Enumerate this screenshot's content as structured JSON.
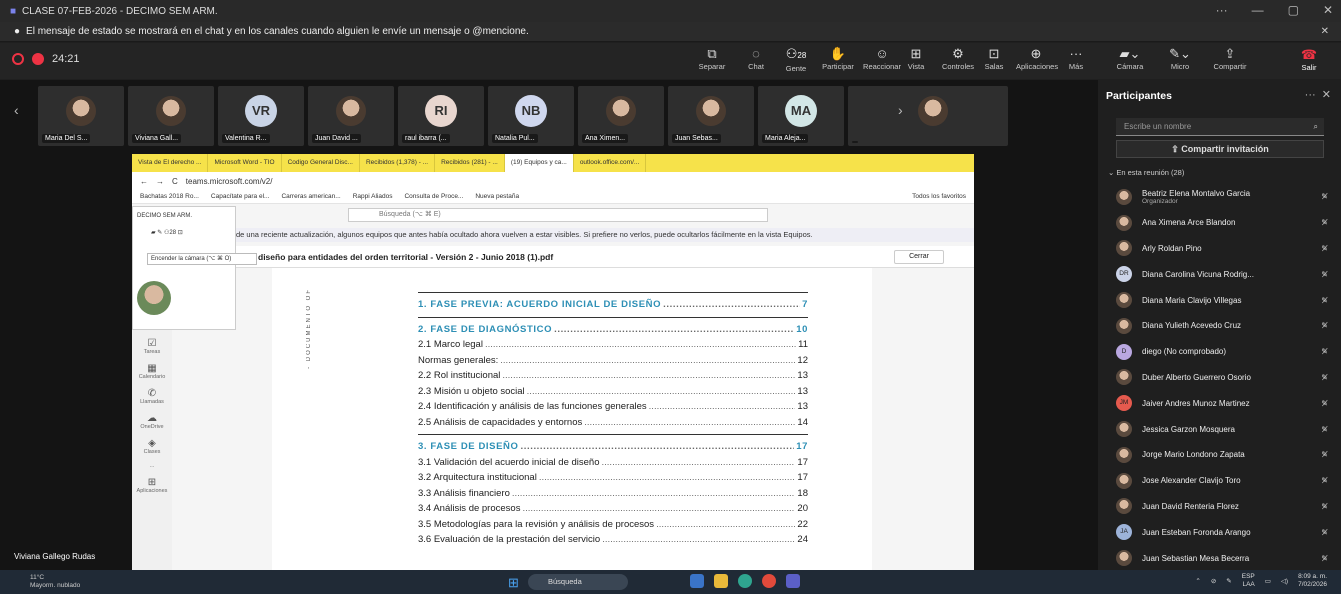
{
  "window": {
    "title": "CLASE 07-FEB-2026 - DECIMO SEM ARM."
  },
  "banner": {
    "message": "El mensaje de estado se mostrará en el chat y en los canales cuando alguien le envíe un mensaje o @mencione."
  },
  "meeting": {
    "timer": "24:21"
  },
  "toolbar": {
    "buttons": [
      "Separar",
      "Chat",
      "Gente",
      "Participar",
      "Reaccionar",
      "Vista",
      "Controles",
      "Salas",
      "Aplicaciones",
      "Más"
    ],
    "people_count": "28",
    "camera": "Cámara",
    "mic": "Micro",
    "share": "Compartir",
    "leave": "Salir"
  },
  "participants_strip": [
    {
      "name": "Maria Del S...",
      "initials": ""
    },
    {
      "name": "Viviana Gall...",
      "initials": ""
    },
    {
      "name": "Valentina R...",
      "initials": "VR",
      "color": "#c9d4e6"
    },
    {
      "name": "Juan David ...",
      "initials": ""
    },
    {
      "name": "raul ibarra (...",
      "initials": "RI",
      "color": "#e8d6cf"
    },
    {
      "name": "Natalia Pul...",
      "initials": "NB",
      "color": "#cfd7ee"
    },
    {
      "name": "Ana Ximen...",
      "initials": ""
    },
    {
      "name": "Juan Sebas...",
      "initials": ""
    },
    {
      "name": "Maria Aleja...",
      "initials": "MA",
      "color": "#d2e6e6"
    },
    {
      "name": "",
      "initials": ""
    }
  ],
  "shared_screen": {
    "tabs": [
      "Vista de El derecho ...",
      "Microsoft Word - TIO",
      "Codigo General Disc...",
      "Recibidos (1,378) - ...",
      "Recibidos (281) - ...",
      "(19) Equipos y ca...",
      "outlook.office.com/..."
    ],
    "url": "teams.microsoft.com/v2/",
    "bookmarks": [
      "Bachatas 2018 Ro...",
      "Capacítate para el...",
      "Carreras american...",
      "Rappi Aliados",
      "Consulta de Proce...",
      "Nueva pestaña"
    ],
    "favorites": "Todos los favoritos",
    "search_placeholder": "Búsqueda (⌥ ⌘ E)",
    "team_name": "DECIMO SEM ARM.",
    "tooltip": "Encender la cámara (⌥ ⌘ O)",
    "people_count": "28",
    "notice": "de una reciente actualización, algunos equipos que antes había ocultado ahora vuelven a estar visibles. Si prefiere no verlos, puede ocultarlos fácilmente en la vista Equipos.",
    "pdf_title": "diseño para entidades del orden territorial - Versión 2 - Junio 2018 (1).pdf",
    "close_label": "Cerrar",
    "vertical_text": "- DOCUMENTO OF",
    "rail": [
      "Tareas",
      "Calendario",
      "Llamadas",
      "OneDrive",
      "Clases",
      "...",
      "Aplicaciones"
    ],
    "toc": [
      {
        "text": "1. FASE PREVIA: ACUERDO INICIAL DE DISEÑO",
        "page": "7",
        "heading": true,
        "rule_after": true
      },
      {
        "text": "2. FASE DE DIAGNÓSTICO",
        "page": "10",
        "heading": true
      },
      {
        "text": "2.1 Marco legal",
        "page": "11"
      },
      {
        "text": "Normas generales:",
        "page": "12"
      },
      {
        "text": "2.2 Rol institucional",
        "page": "13"
      },
      {
        "text": "2.3 Misión u objeto social",
        "page": "13"
      },
      {
        "text": "2.4 Identificación y análisis de las funciones generales",
        "page": "13"
      },
      {
        "text": "2.5 Análisis de capacidades y entornos",
        "page": "14",
        "rule_after": true
      },
      {
        "text": "3. FASE DE DISEÑO",
        "page": "17",
        "heading": true
      },
      {
        "text": "3.1 Validación del acuerdo inicial de diseño",
        "page": "17"
      },
      {
        "text": "3.2 Arquitectura institucional",
        "page": "17"
      },
      {
        "text": "3.3 Análisis financiero",
        "page": "18"
      },
      {
        "text": "3.4 Análisis de procesos",
        "page": "20"
      },
      {
        "text": "3.5 Metodologías para la revisión y análisis de procesos",
        "page": "22"
      },
      {
        "text": "3.6 Evaluación de la prestación del servicio",
        "page": "24"
      }
    ]
  },
  "presenter_name": "Viviana Gallego Rudas",
  "panel": {
    "title": "Participantes",
    "search_placeholder": "Escribe un nombre",
    "invite": "Compartir invitación",
    "section": "En esta reunión (28)",
    "people": [
      {
        "name": "Beatriz Elena Montalvo Garcia",
        "sub": "Organizador"
      },
      {
        "name": "Ana Ximena Arce Blandon"
      },
      {
        "name": "Arly Roldan Pino"
      },
      {
        "name": "Diana Carolina Vicuna Rodrig...",
        "initials": "DR",
        "color": "#cbd3e8"
      },
      {
        "name": "Diana Maria Clavijo Villegas"
      },
      {
        "name": "Diana Yulieth Acevedo Cruz"
      },
      {
        "name": "diego (No comprobado)",
        "initials": "D",
        "color": "#b9a7e0"
      },
      {
        "name": "Duber Alberto Guerrero Osorio"
      },
      {
        "name": "Jaiver Andres Munoz Martinez",
        "initials": "JM",
        "color": "#e55a4e"
      },
      {
        "name": "Jessica Garzon Mosquera"
      },
      {
        "name": "Jorge Mario Londono Zapata"
      },
      {
        "name": "Jose Alexander Clavijo Toro"
      },
      {
        "name": "Juan David Renteria Florez"
      },
      {
        "name": "Juan Esteban Foronda Arango",
        "initials": "JA",
        "color": "#9db3d9"
      },
      {
        "name": "Juan Sebastian Mesa Becerra"
      }
    ]
  },
  "taskbar": {
    "temp": "11°C",
    "weather": "Mayorm. nublado",
    "search": "Búsqueda",
    "lang": "ESP",
    "lang2": "LAA",
    "time": "8:09 a. m.",
    "date": "7/02/2026"
  }
}
